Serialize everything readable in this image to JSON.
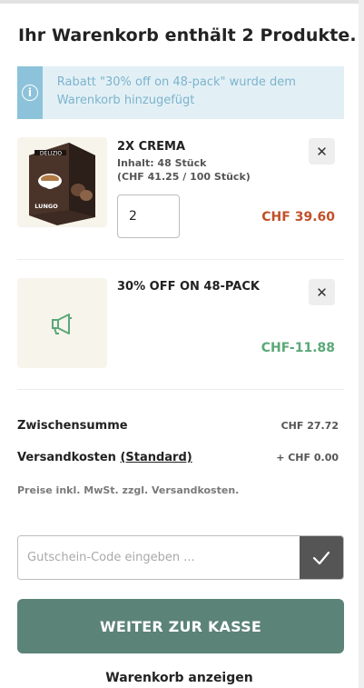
{
  "cart": {
    "title": "Ihr Warenkorb enthält 2 Produkte.",
    "notice": "Rabatt \"30% off on 48-pack\" wurde dem Warenkorb hinzugefügt",
    "items": [
      {
        "name": "2X CREMA",
        "content": "Inhalt: 48 Stück",
        "unit_price": "(CHF 41.25 / 100 Stück)",
        "quantity": "2",
        "price": "CHF 39.60",
        "price_color": "#c0502a",
        "package_brand": "DELIZIO",
        "package_label": "LUNGO"
      },
      {
        "name": "30% OFF ON 48-PACK",
        "price": "CHF-11.88",
        "price_color": "#5aa877",
        "icon": "megaphone-icon"
      }
    ],
    "summary": {
      "subtotal_label": "Zwischensumme",
      "subtotal_value": "CHF 27.72",
      "shipping_label": "Versandkosten",
      "shipping_link": "(Standard)",
      "shipping_value": "+ CHF 0.00",
      "tax_note": "Preise inkl. MwSt. zzgl. Versandkosten."
    },
    "coupon": {
      "placeholder": "Gutschein-Code eingeben ..."
    },
    "checkout_label": "WEITER ZUR KASSE",
    "view_cart_label": "Warenkorb anzeigen"
  },
  "colors": {
    "accent": "#5b8378",
    "notice_bg": "#e2f0f6",
    "notice_icon_bg": "#8dc3da",
    "discount": "#5aa877",
    "price": "#c0502a"
  }
}
